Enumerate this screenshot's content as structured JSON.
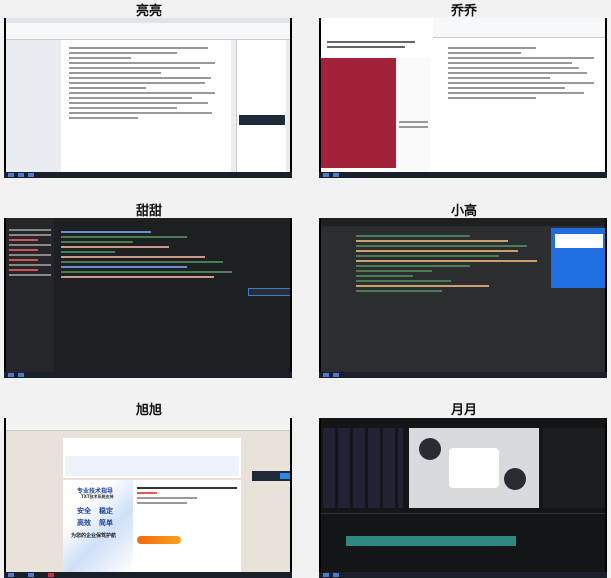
{
  "panels": [
    {
      "name": "亮亮",
      "kind": "word-document"
    },
    {
      "name": "乔乔",
      "kind": "browser-and-document"
    },
    {
      "name": "甜甜",
      "kind": "code-editor"
    },
    {
      "name": "小高",
      "kind": "code-editor"
    },
    {
      "name": "旭旭",
      "kind": "browser-product-page",
      "ad": {
        "title": "专业技术指导",
        "subtitle": "TXT技术系统支持",
        "words": [
          "安全",
          "稳定",
          "高效",
          "简单"
        ],
        "slogan": "为您的企业保驾护航"
      }
    },
    {
      "name": "月月",
      "kind": "video-editor"
    }
  ]
}
